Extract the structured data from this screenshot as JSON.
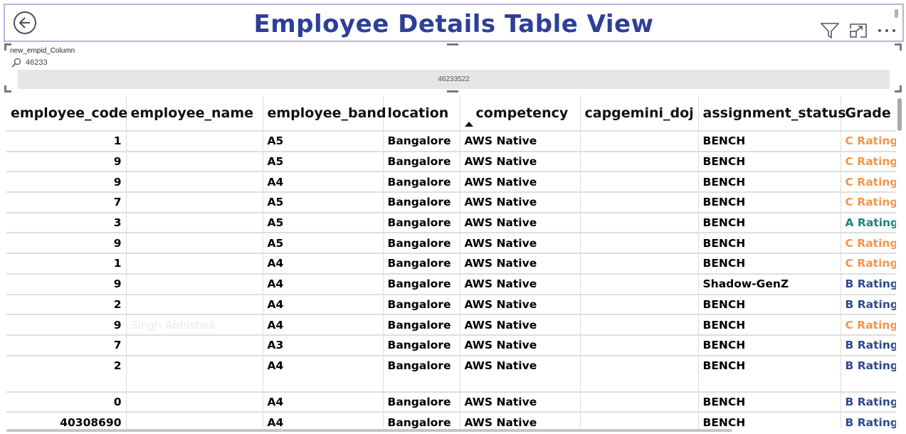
{
  "header": {
    "title": "Employee Details Table View",
    "icons": [
      "back-arrow-icon",
      "filter-icon",
      "focus-mode-icon",
      "more-options-icon"
    ]
  },
  "slicer": {
    "field_label": "new_empid_Column",
    "search_value": "46233",
    "search_icon": "search-icon",
    "items": [
      "46233522"
    ]
  },
  "table": {
    "columns": [
      "employee_code",
      "employee_name",
      "employee_band",
      "location",
      "competency",
      "capgemini_doj",
      "assignment_status",
      "Grade"
    ],
    "sorted_column": "competency",
    "sort_direction": "ascending",
    "rows": [
      {
        "employee_code": "1",
        "employee_name": "",
        "employee_band": "A5",
        "location": "Bangalore",
        "competency": "AWS Native",
        "capgemini_doj": "",
        "assignment_status": "BENCH",
        "grade": "C Rating"
      },
      {
        "employee_code": "9",
        "employee_name": "",
        "employee_band": "A5",
        "location": "Bangalore",
        "competency": "AWS Native",
        "capgemini_doj": "",
        "assignment_status": "BENCH",
        "grade": "C Rating"
      },
      {
        "employee_code": "9",
        "employee_name": "",
        "employee_band": "A4",
        "location": "Bangalore",
        "competency": "AWS Native",
        "capgemini_doj": "",
        "assignment_status": "BENCH",
        "grade": "C Rating"
      },
      {
        "employee_code": "7",
        "employee_name": "",
        "employee_band": "A5",
        "location": "Bangalore",
        "competency": "AWS Native",
        "capgemini_doj": "",
        "assignment_status": "BENCH",
        "grade": "C Rating"
      },
      {
        "employee_code": "3",
        "employee_name": "",
        "employee_band": "A5",
        "location": "Bangalore",
        "competency": "AWS Native",
        "capgemini_doj": "",
        "assignment_status": "BENCH",
        "grade": "A Rating"
      },
      {
        "employee_code": "9",
        "employee_name": "",
        "employee_band": "A5",
        "location": "Bangalore",
        "competency": "AWS Native",
        "capgemini_doj": "",
        "assignment_status": "BENCH",
        "grade": "C Rating"
      },
      {
        "employee_code": "1",
        "employee_name": "",
        "employee_band": "A4",
        "location": "Bangalore",
        "competency": "AWS Native",
        "capgemini_doj": "",
        "assignment_status": "BENCH",
        "grade": "C Rating"
      },
      {
        "employee_code": "9",
        "employee_name": "",
        "employee_band": "A4",
        "location": "Bangalore",
        "competency": "AWS Native",
        "capgemini_doj": "",
        "assignment_status": "Shadow-GenZ",
        "grade": "B Rating"
      },
      {
        "employee_code": "2",
        "employee_name": "",
        "employee_band": "A4",
        "location": "Bangalore",
        "competency": "AWS Native",
        "capgemini_doj": "",
        "assignment_status": "BENCH",
        "grade": "B Rating"
      },
      {
        "employee_code": "9",
        "employee_name": "Singh Abhishek",
        "employee_band": "A4",
        "location": "Bangalore",
        "competency": "AWS Native",
        "capgemini_doj": "",
        "assignment_status": "BENCH",
        "grade": "C Rating"
      },
      {
        "employee_code": "7",
        "employee_name": "",
        "employee_band": "A3",
        "location": "Bangalore",
        "competency": "AWS Native",
        "capgemini_doj": "",
        "assignment_status": "BENCH",
        "grade": "B Rating"
      },
      {
        "employee_code": "2",
        "employee_name": "",
        "employee_band": "A4",
        "location": "Bangalore",
        "competency": "AWS Native",
        "capgemini_doj": "",
        "assignment_status": "BENCH",
        "grade": "B Rating",
        "tall": true
      },
      {
        "employee_code": "0",
        "employee_name": "",
        "employee_band": "A4",
        "location": "Bangalore",
        "competency": "AWS Native",
        "capgemini_doj": "",
        "assignment_status": "BENCH",
        "grade": "B Rating"
      },
      {
        "employee_code": "40308690",
        "employee_name": "",
        "employee_band": "A4",
        "location": "Bangalore",
        "competency": "AWS Native",
        "capgemini_doj": "",
        "assignment_status": "BENCH",
        "grade": "B Rating"
      }
    ]
  },
  "colors": {
    "title": "#2f3f95",
    "header_border": "#b7b2e8",
    "grade_A": "#1c8577",
    "grade_B": "#2f4a93",
    "grade_C": "#f2954b"
  }
}
